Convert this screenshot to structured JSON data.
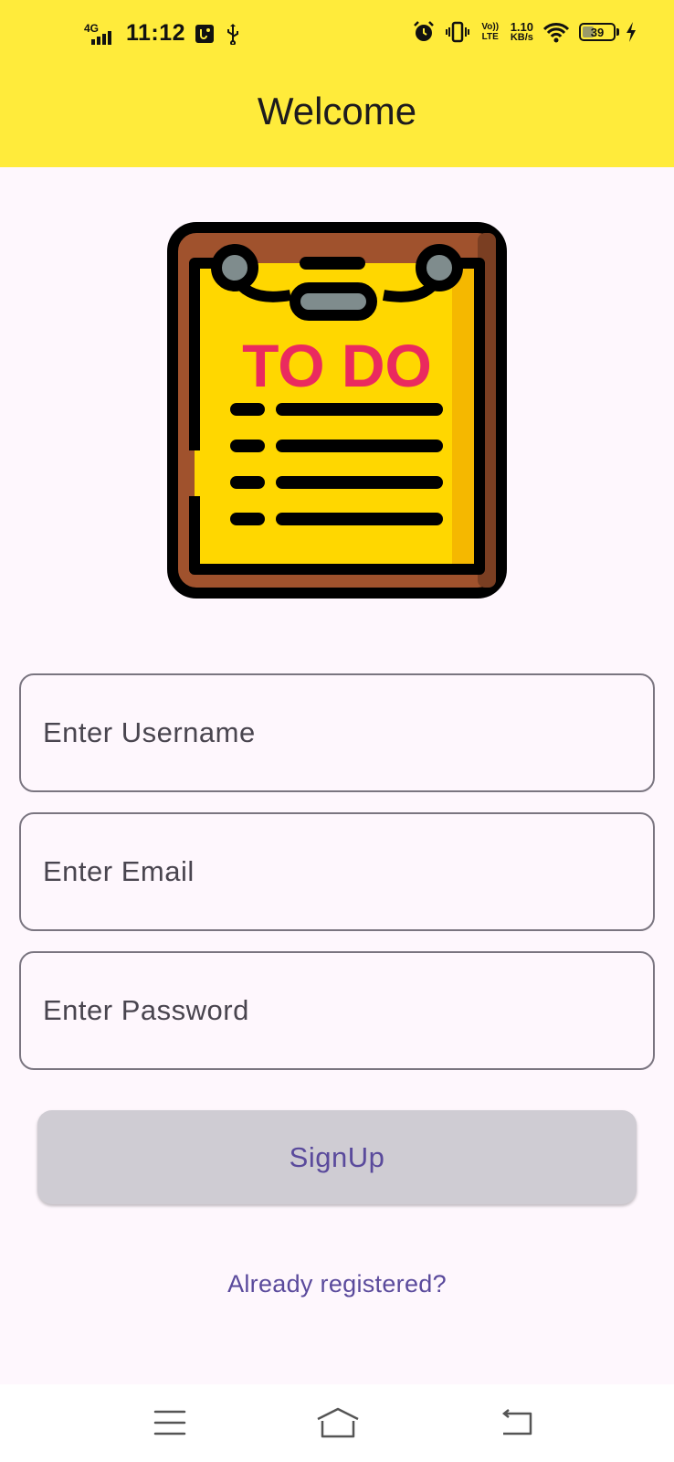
{
  "status_bar": {
    "network": "4G",
    "time": "11:12",
    "volte": "Vo)) LTE",
    "speed_value": "1.10",
    "speed_unit": "KB/s",
    "battery": "39",
    "battery_level": 0.39
  },
  "header": {
    "title": "Welcome",
    "background": "#ffeb3b"
  },
  "logo": {
    "icon": "todo-clipboard-icon",
    "text": "TO DO"
  },
  "form": {
    "username_placeholder": "Enter Username",
    "email_placeholder": "Enter Email",
    "password_placeholder": "Enter Password",
    "signup_label": "SignUp",
    "login_link": "Already registered?"
  },
  "nav": {
    "menu_icon": "menu-icon",
    "home_icon": "home-icon",
    "back_icon": "back-icon"
  },
  "colors": {
    "accent": "#5a4a9c",
    "page_background": "#fef7fd",
    "button_background": "#cfccd3"
  }
}
